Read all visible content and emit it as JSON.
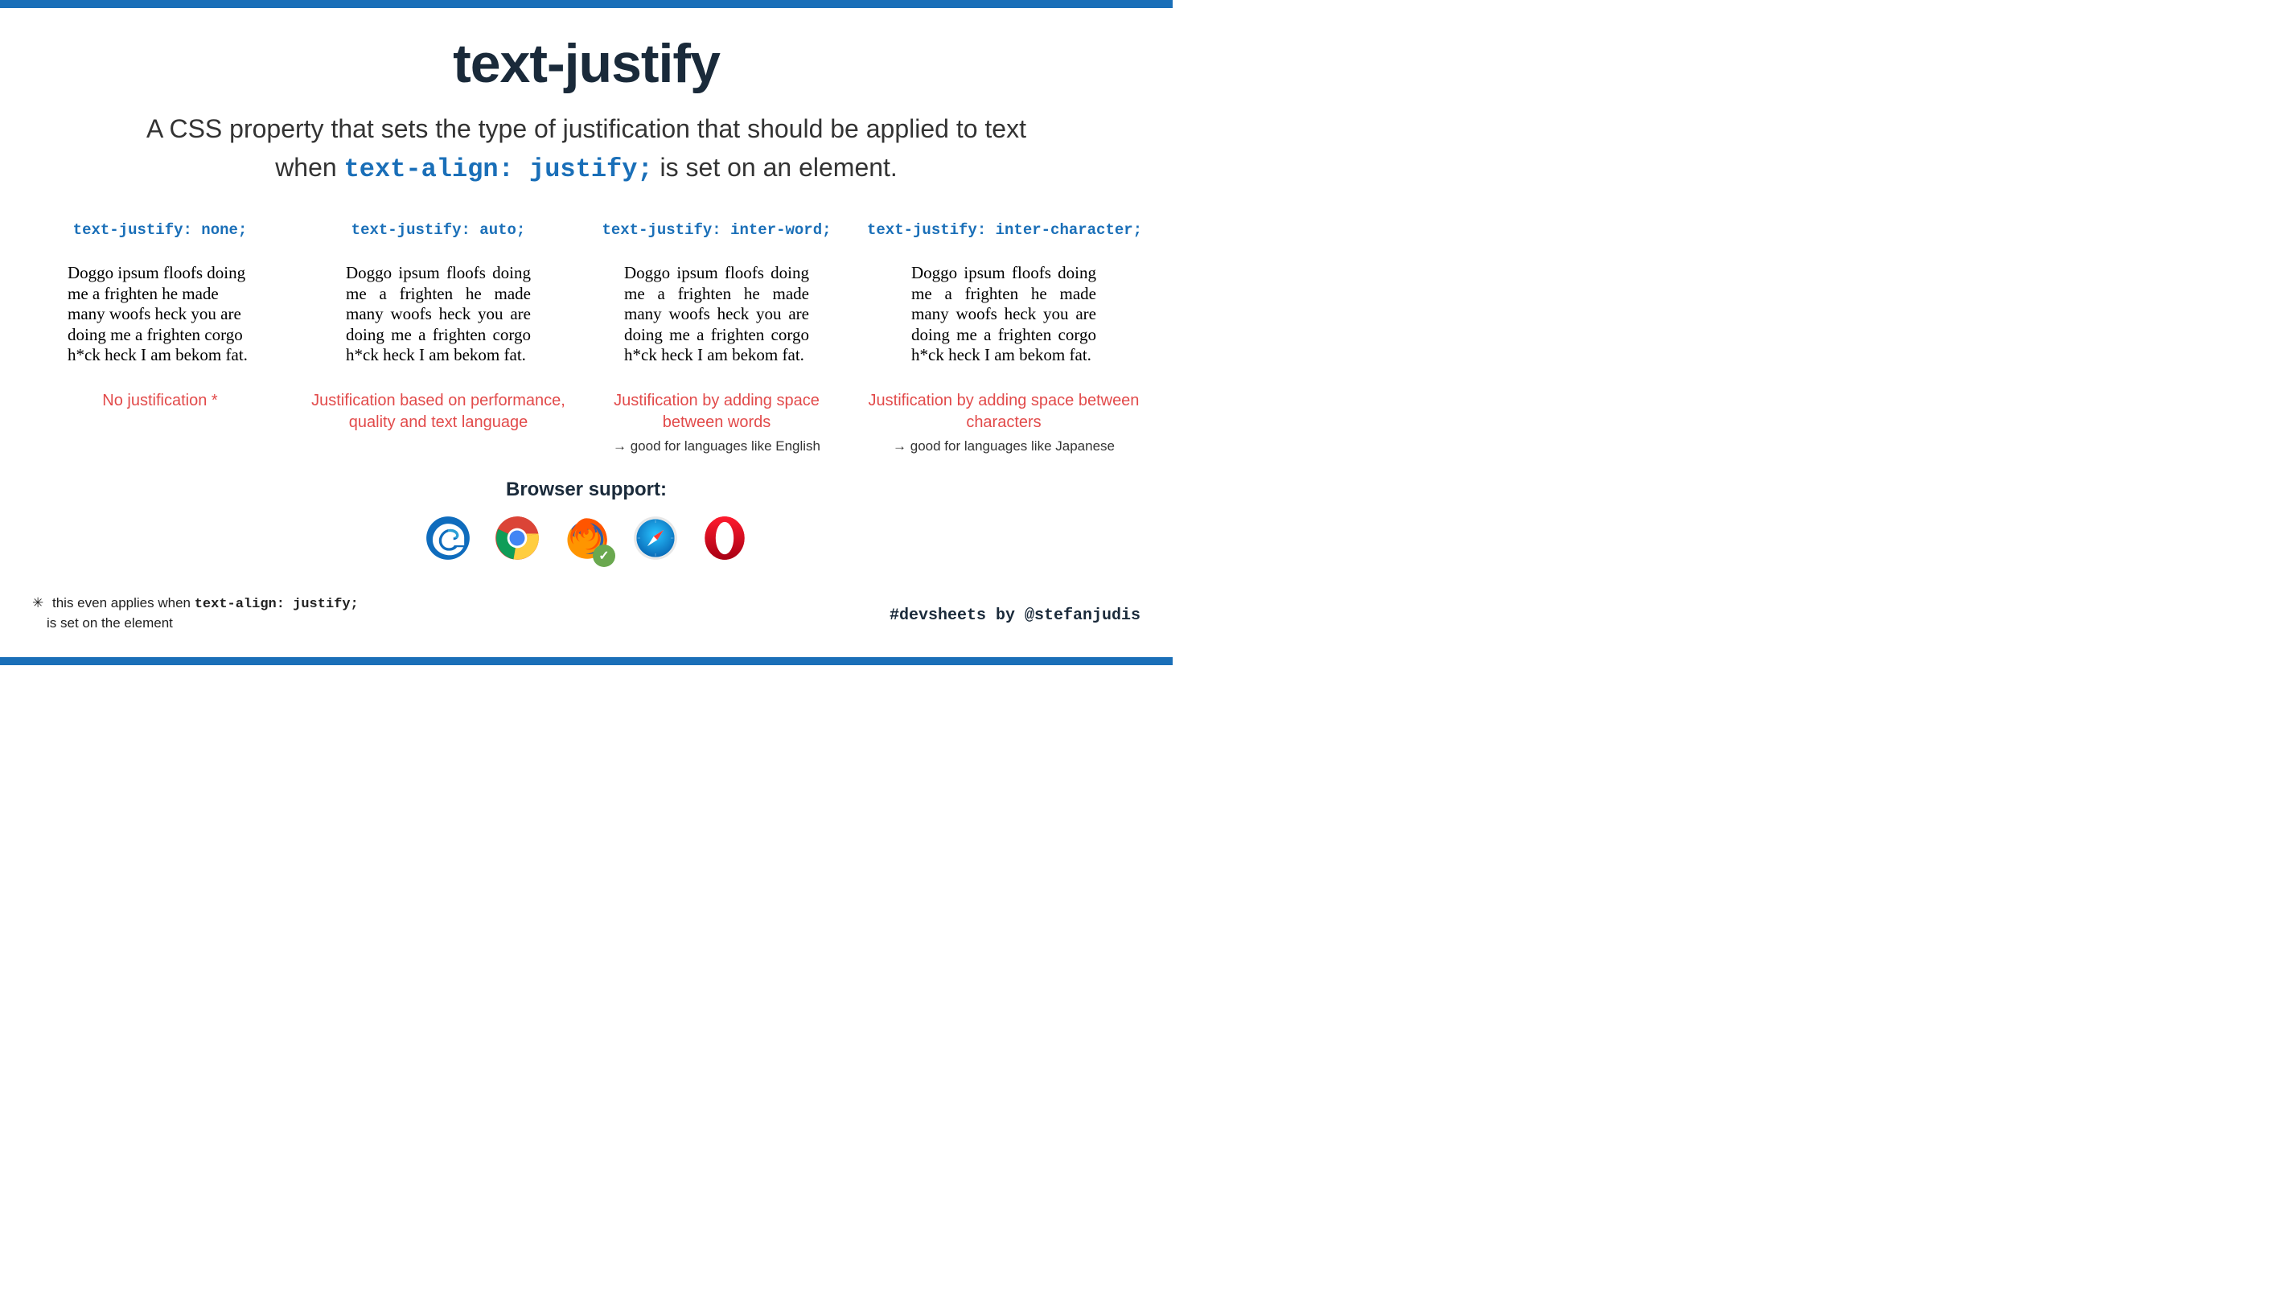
{
  "title": "text-justify",
  "subtitle": {
    "line1_pre": "A CSS property that sets the type of justification that should be applied to text",
    "line2_pre": "when ",
    "code": "text-align: justify;",
    "line2_post": " is set on an element."
  },
  "sample_text": "Doggo ipsum floofs doing me a frighten he made many woofs heck you are doing me a frighten corgo h*ck heck I am bekom fat.",
  "columns": [
    {
      "header": "text-justify: none;",
      "caption": "No justification *",
      "note": ""
    },
    {
      "header": "text-justify: auto;",
      "caption": "Justification based on performance, quality and text language",
      "note": ""
    },
    {
      "header": "text-justify: inter-word;",
      "caption": "Justification by adding space between words",
      "note": "→ good for languages like English"
    },
    {
      "header": "text-justify: inter-character;",
      "caption": "Justification by adding space between characters",
      "note": "→ good for languages like Japanese"
    }
  ],
  "support": {
    "title": "Browser support:",
    "browsers": [
      "edge",
      "chrome",
      "firefox",
      "safari",
      "opera"
    ],
    "checked": "firefox"
  },
  "footnote": {
    "star": "✳",
    "text_pre": "this even applies when ",
    "code": "text-align: justify;",
    "text_post": "is set on the element"
  },
  "credit": "#devsheets by @stefanjudis"
}
